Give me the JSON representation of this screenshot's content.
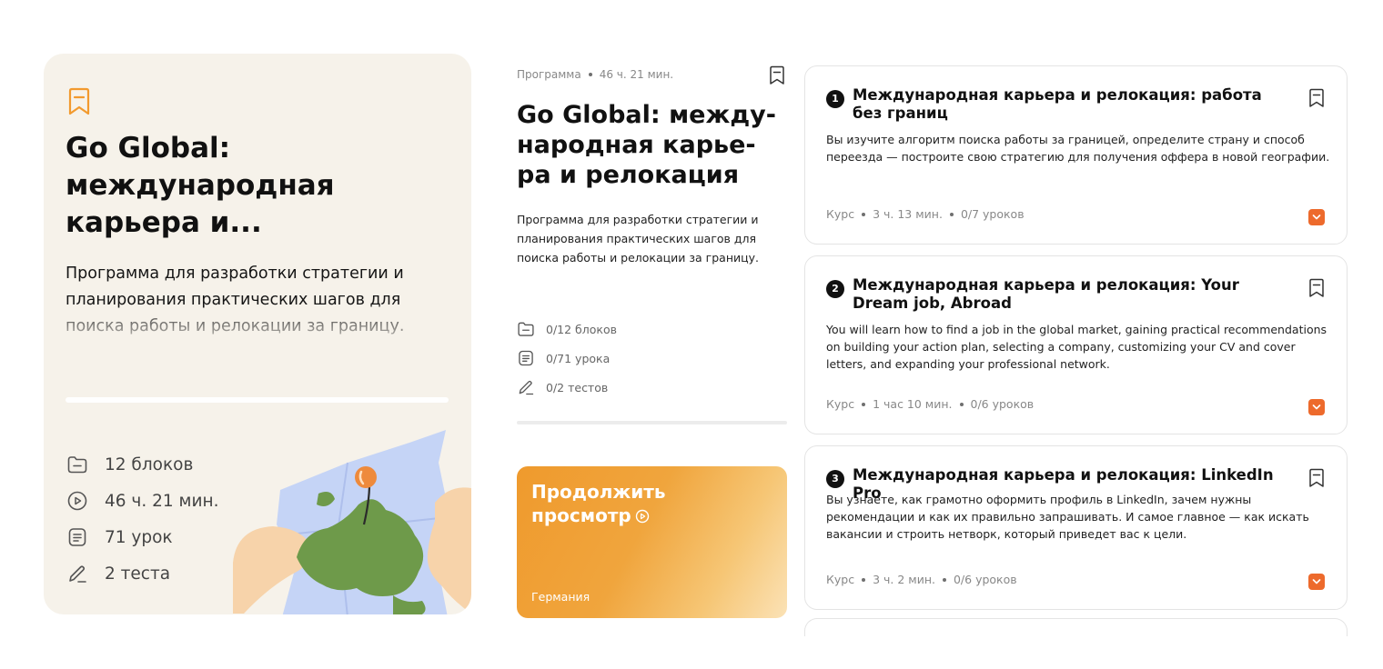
{
  "hero": {
    "title": "Go Global: международная карьера и...",
    "description": "Программа для разработки стратегии и планирования практических шагов для поиска работы и релокации за границу.",
    "stats": [
      {
        "icon": "folder-icon",
        "label": "12 блоков"
      },
      {
        "icon": "play-circle-icon",
        "label": "46 ч. 21 мин."
      },
      {
        "icon": "document-icon",
        "label": "71 урок"
      },
      {
        "icon": "pencil-icon",
        "label": "2 теста"
      }
    ]
  },
  "program": {
    "type": "Программа",
    "duration": "46 ч. 21 мин.",
    "title": "Go Global: между-народная карье-ра и релокация",
    "description": "Программа для разработки стратегии и планирования практических шагов для поиска работы и релокации за границу.",
    "progress": [
      {
        "icon": "folder-icon",
        "label": "0/12 блоков"
      },
      {
        "icon": "document-icon",
        "label": "0/71 урока"
      },
      {
        "icon": "pencil-icon",
        "label": "0/2 тестов"
      }
    ]
  },
  "continue": {
    "label": "Продолжить просмотр",
    "country": "Германия"
  },
  "courses": [
    {
      "number": "1",
      "title": "Международная карьера и релокация: работа без границ",
      "description": "Вы изучите алгоритм поиска работы за границей, определите страну и способ переезда — построите свою стратегию для получения оффера в новой географии.",
      "type": "Курс",
      "duration": "3 ч. 13 мин.",
      "lessons": "0/7 уроков"
    },
    {
      "number": "2",
      "title": "Международная карьера и релокация: Your Dream job, Abroad",
      "description": "You will learn how to find a job in the global market, gaining practical recommendations on building your action plan, selecting a company, customizing your CV and cover letters, and expanding your professional network.",
      "type": "Курс",
      "duration": "1 час 10 мин.",
      "lessons": "0/6 уроков"
    },
    {
      "number": "3",
      "title": "Международная карьера и релокация: LinkedIn Pro",
      "description": "Вы узнаете, как грамотно оформить профиль в LinkedIn, зачем нужны рекомендации и как их правильно запрашивать. И самое главное — как искать вакансии и строить нетворк, который приведет вас к цели.",
      "type": "Курс",
      "duration": "3 ч. 2 мин.",
      "lessons": "0/6 уроков"
    }
  ],
  "colors": {
    "accent": "#ed6a2c",
    "hero_bg": "#f6f2ea",
    "bookmark_orange": "#f29a2e"
  }
}
